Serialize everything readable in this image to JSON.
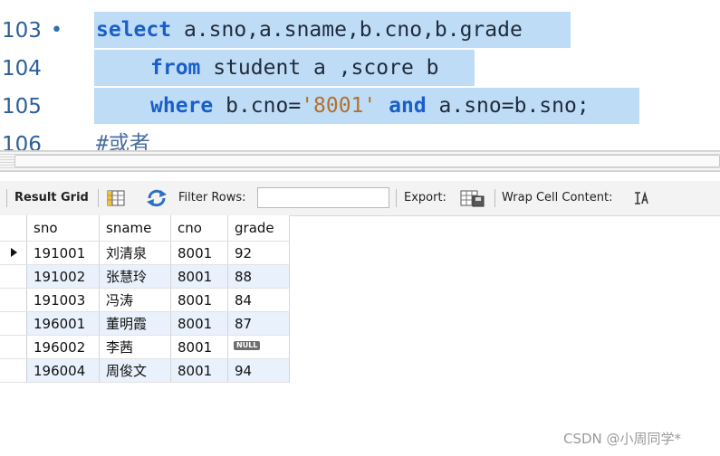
{
  "editor": {
    "lines": [
      {
        "num": "103",
        "marker": "•"
      },
      {
        "num": "104",
        "marker": ""
      },
      {
        "num": "105",
        "marker": ""
      },
      {
        "num": "106",
        "marker": ""
      }
    ],
    "tokens": {
      "l103_kw": "select",
      "l103_rest": " a.sno,a.sname,b.cno,b.grade",
      "l104_kw": "from",
      "l104_rest": " student a ,score b",
      "l105_kw1": "where",
      "l105_mid": " b.cno=",
      "l105_str": "'8001'",
      "l105_kw2": " and",
      "l105_rest": " a.sno=b.sno;",
      "l106_comment": "#或者"
    }
  },
  "toolbar": {
    "result_grid_tab": "Result Grid",
    "filter_rows_label": "Filter Rows:",
    "filter_rows_value": "",
    "export_label": "Export:",
    "wrap_label": "Wrap Cell Content:"
  },
  "grid": {
    "columns": [
      "sno",
      "sname",
      "cno",
      "grade"
    ],
    "rows": [
      {
        "sno": "191001",
        "sname": "刘清泉",
        "cno": "8001",
        "grade": "92"
      },
      {
        "sno": "191002",
        "sname": "张慧玲",
        "cno": "8001",
        "grade": "88"
      },
      {
        "sno": "191003",
        "sname": "冯涛",
        "cno": "8001",
        "grade": "84"
      },
      {
        "sno": "196001",
        "sname": "董明霞",
        "cno": "8001",
        "grade": "87"
      },
      {
        "sno": "196002",
        "sname": "李茜",
        "cno": "8001",
        "grade": "NULL"
      },
      {
        "sno": "196004",
        "sname": "周俊文",
        "cno": "8001",
        "grade": "94"
      }
    ]
  },
  "watermark": "CSDN @小周同学*"
}
